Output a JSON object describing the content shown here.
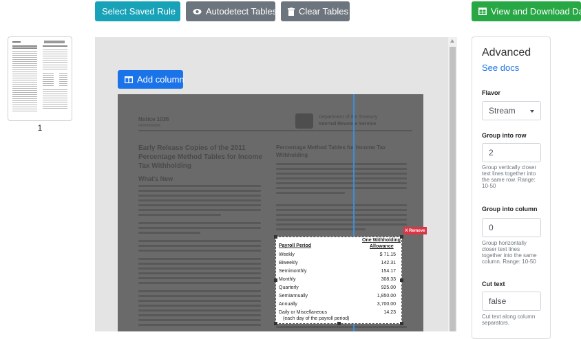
{
  "toolbar": {
    "select_rule_label": "Select Saved Rule",
    "autodetect_label": "Autodetect Tables",
    "clear_label": "Clear Tables",
    "download_label": "View and Download Data"
  },
  "thumbnail": {
    "page_number": "1"
  },
  "viewer": {
    "add_column_label": "Add column",
    "remove_label": "X Remove",
    "doc": {
      "notice": "Notice 1036",
      "dept": "Department of the Treasury",
      "irs": "Internal Revenue Service",
      "heading_left": "Early Release Copies of the 2011 Percentage Method Tables for Income Tax Withholding",
      "heading_right": "Percentage Method Tables for Income Tax Withholding",
      "whats_new": "What's New"
    },
    "table": {
      "header_left": "Payroll Period",
      "header_right_1": "One Withholding",
      "header_right_2": "Allowance",
      "rows": [
        {
          "period": "Weekly",
          "amount": "$  71.15"
        },
        {
          "period": "Biweekly",
          "amount": "142.31"
        },
        {
          "period": "Semimonthly",
          "amount": "154.17"
        },
        {
          "period": "Monthly",
          "amount": "308.33"
        },
        {
          "period": "Quarterly",
          "amount": "925.00"
        },
        {
          "period": "Semiannually",
          "amount": "1,850.00"
        },
        {
          "period": "Annually",
          "amount": "3,700.00"
        },
        {
          "period": "Daily or Miscellaneous",
          "amount": "14.23"
        }
      ],
      "row_note": "(each day of the payroll period)"
    }
  },
  "panel": {
    "title": "Advanced",
    "docs_link": "See docs",
    "flavor_label": "Flavor",
    "flavor_value": "Stream",
    "row_label": "Group into row",
    "row_value": "2",
    "row_help": "Group vertically closer text lines together into the same row. Range: 10-50",
    "col_label": "Group into column",
    "col_value": "0",
    "col_help": "Group horizontally closer text lines together into the same column. Range: 10-50",
    "cut_label": "Cut text",
    "cut_value": "false",
    "cut_help": "Cut text along column separators."
  },
  "colors": {
    "teal": "#17a2b8",
    "gray": "#6c757d",
    "green": "#28a745",
    "blue": "#1a73e8",
    "red": "#dc3545"
  }
}
